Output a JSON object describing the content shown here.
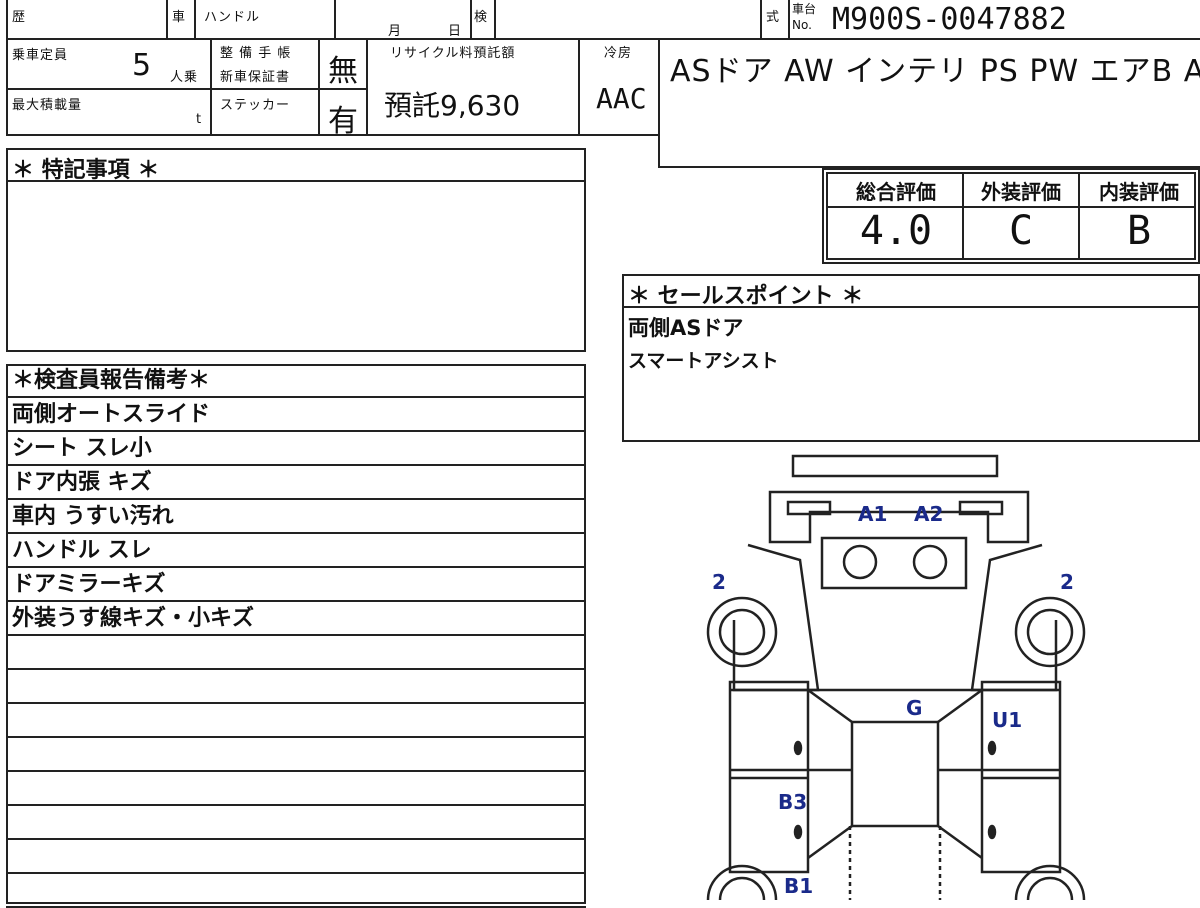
{
  "header": {
    "history_label": "歴",
    "car_label": "車",
    "handle_label": "ハンドル",
    "month_label": "月",
    "day_label": "日",
    "inspection_label": "検",
    "type_label": "式",
    "chassis_label_top": "車台",
    "chassis_label_no": "No.",
    "chassis_number": "M900S-0047882"
  },
  "specs": {
    "capacity_label": "乗車定員",
    "capacity_value": "5",
    "capacity_unit": "人乗",
    "max_load_label": "最大積載量",
    "max_load_unit": "t",
    "maintenance_label": "整 備 手 帳",
    "warranty_label": "新車保証書",
    "sticker_label": "ステッカー",
    "maintenance_value": "無",
    "sticker_value": "有",
    "recycle_label": "リサイクル料預託額",
    "recycle_value": "預託9,630",
    "ac_label": "冷房",
    "ac_value": "AAC",
    "equipment": "ASドア AW インテリ PS PW エアB ABS"
  },
  "grades": {
    "overall_label": "総合評価",
    "exterior_label": "外装評価",
    "interior_label": "内装評価",
    "overall_value": "4.0",
    "exterior_value": "C",
    "interior_value": "B"
  },
  "special_notes": {
    "title": "＊ 特記事項 ＊"
  },
  "sales_points": {
    "title": "＊ セールスポイント ＊",
    "items": [
      "両側ASドア",
      "スマートアシスト"
    ]
  },
  "inspector_report": {
    "title": "＊検査員報告備考＊",
    "items": [
      "両側オートスライド",
      "シート スレ小",
      "ドア内張 キズ",
      "車内 うすい汚れ",
      "ハンドル スレ",
      "ドアミラーキズ",
      "外装うす線キズ・小キズ",
      "",
      "",
      "",
      "",
      "",
      "",
      "",
      ""
    ]
  },
  "diagram_labels": {
    "a1": "A1",
    "a2": "A2",
    "left_fender": "2",
    "right_fender": "2",
    "glass": "G",
    "u1": "U1",
    "b3": "B3",
    "b1": "B1"
  },
  "colors": {
    "border": "#222222",
    "diagram_label": "#1a2a8a"
  }
}
